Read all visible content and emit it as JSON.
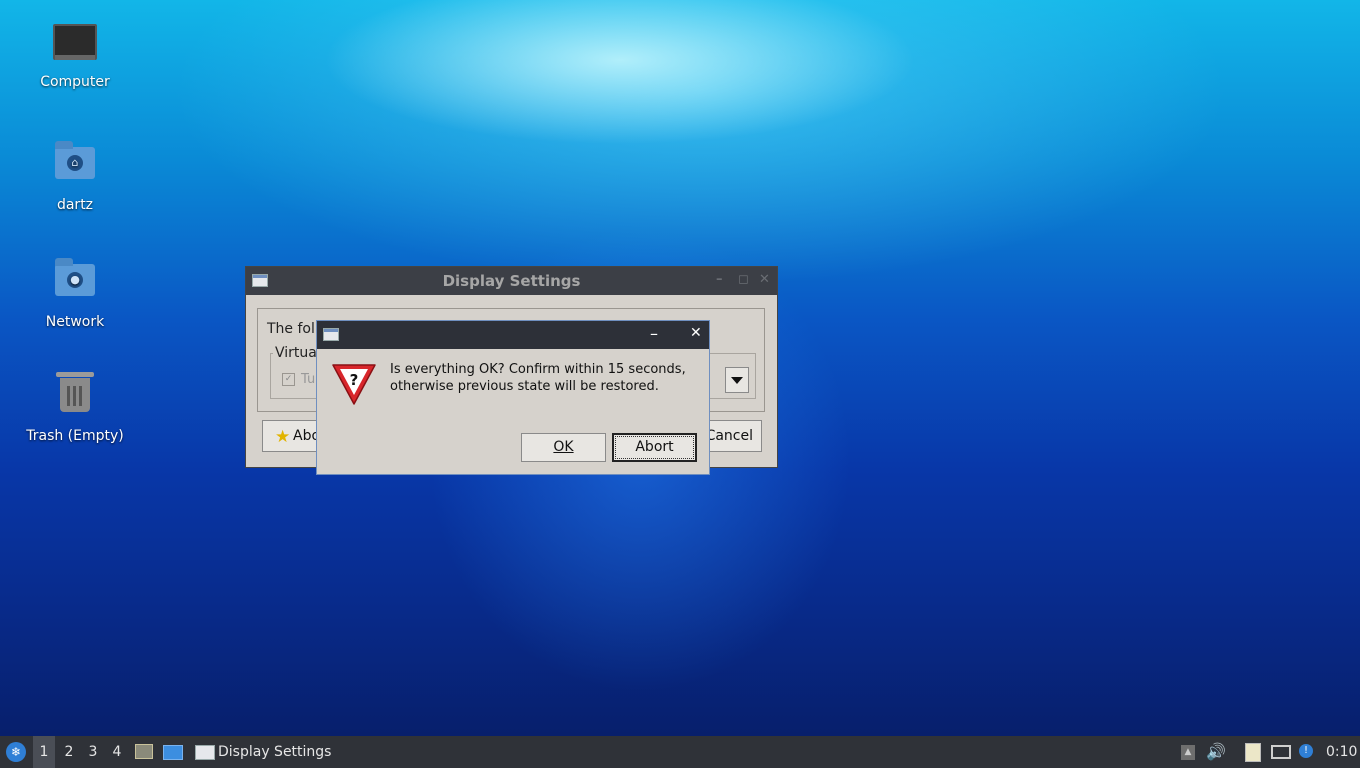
{
  "desktop": {
    "icons": [
      {
        "label": "Computer",
        "icon": "computer-icon"
      },
      {
        "label": "dartz",
        "icon": "home-folder-icon"
      },
      {
        "label": "Network",
        "icon": "network-folder-icon"
      },
      {
        "label": "Trash (Empty)",
        "icon": "trash-icon"
      }
    ]
  },
  "display_settings": {
    "title": "Display Settings",
    "body_text": "The foll",
    "group_label": "Virtual",
    "checkbox_label": "Tu",
    "about_label": "Abo",
    "cancel_label": "Cancel"
  },
  "confirm_dialog": {
    "message_line1": "Is everything OK? Confirm within 15 seconds,",
    "message_line2": "otherwise previous state will be restored.",
    "ok_label": "OK",
    "abort_label": "Abort",
    "minimize_glyph": "–",
    "close_glyph": "✕"
  },
  "taskbar": {
    "workspaces": [
      "1",
      "2",
      "3",
      "4"
    ],
    "active_workspace": "1",
    "window_button_label": "Display Settings",
    "clock": "0:10"
  },
  "colors": {
    "taskbar_bg": "#2f3238",
    "titlebar_bg": "#3c3f46",
    "dialog_border": "#6f8fc0",
    "warning_red": "#d8262b"
  }
}
